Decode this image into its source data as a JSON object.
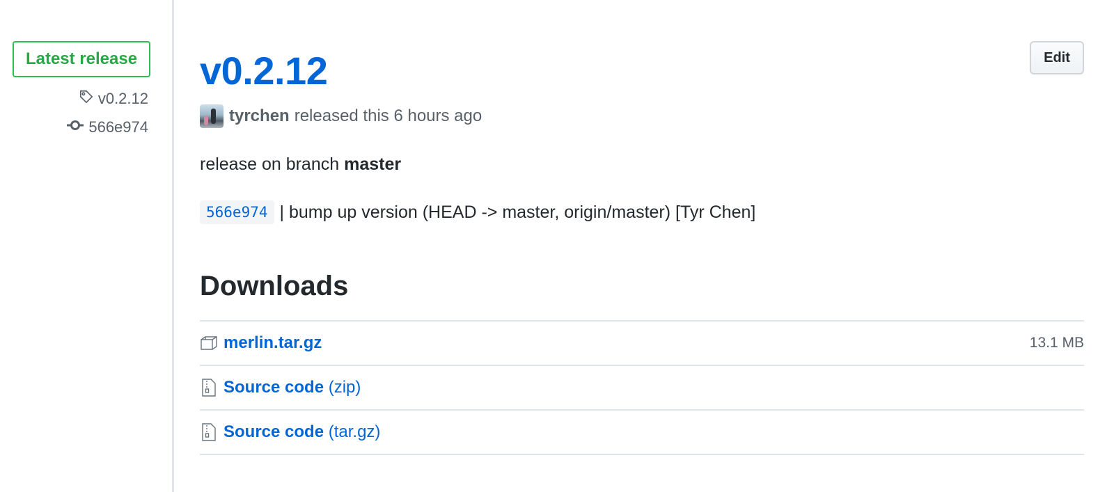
{
  "sidebar": {
    "badge_label": "Latest release",
    "tag": "v0.2.12",
    "commit": "566e974",
    "tag_icon": "tag-icon",
    "commit_icon": "commit-icon"
  },
  "release": {
    "title": "v0.2.12",
    "edit_label": "Edit",
    "author": "tyrchen",
    "released_text": "released this 6 hours ago",
    "body_prefix": "release on branch",
    "body_branch": "master",
    "commit_sha": "566e974",
    "commit_message": "| bump up version (HEAD -> master, origin/master) [Tyr Chen]"
  },
  "downloads": {
    "heading": "Downloads",
    "items": [
      {
        "name": "merlin.tar.gz",
        "ext": "",
        "size": "13.1 MB",
        "icon": "package-icon"
      },
      {
        "name": "Source code",
        "ext": "(zip)",
        "size": "",
        "icon": "file-zip-icon"
      },
      {
        "name": "Source code",
        "ext": "(tar.gz)",
        "size": "",
        "icon": "file-zip-icon"
      }
    ]
  },
  "colors": {
    "link": "#0366d6",
    "badge_green": "#28a745",
    "muted": "#586069",
    "text": "#24292e",
    "border": "#e1e4e8"
  }
}
